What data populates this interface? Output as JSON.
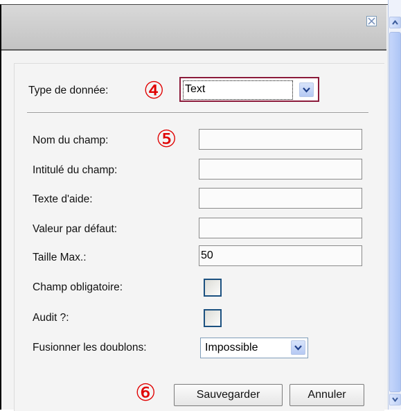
{
  "dialog": {
    "close_icon": "close-x-icon"
  },
  "form": {
    "type_label": "Type de donnée:",
    "type_value": "Text",
    "fields": [
      {
        "label": "Nom du champ:",
        "value": ""
      },
      {
        "label": "Intitulé du champ:",
        "value": ""
      },
      {
        "label": "Texte d'aide:",
        "value": ""
      },
      {
        "label": "Valeur par défaut:",
        "value": ""
      },
      {
        "label": "Taille Max.:",
        "value": "50"
      }
    ],
    "required_label": "Champ obligatoire:",
    "required_checked": false,
    "audit_label": "Audit ?:",
    "audit_checked": false,
    "merge_label": "Fusionner les doublons:",
    "merge_value": "Impossible",
    "save_label": "Sauvegarder",
    "cancel_label": "Annuler"
  },
  "annotations": {
    "step4": "④",
    "step5": "⑤",
    "step6": "⑥",
    "color": "#e00000"
  },
  "colors": {
    "focus_border": "#8b1a3a",
    "checkbox_border": "#1c5180",
    "select_border": "#7f9db9"
  }
}
